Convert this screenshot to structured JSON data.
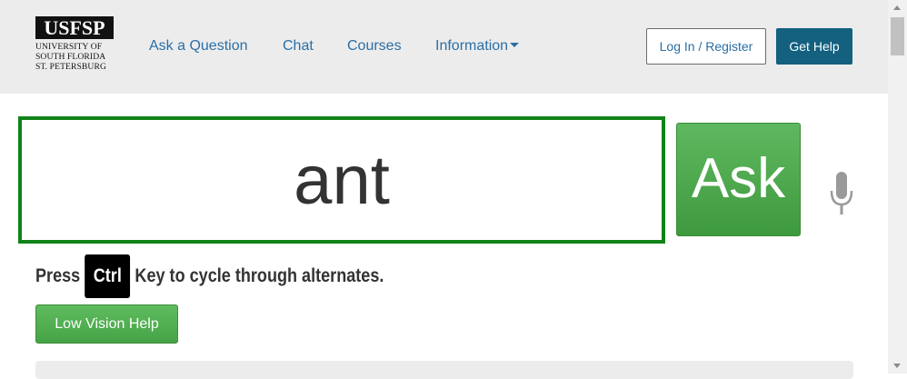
{
  "logo": {
    "mark": "USFSP",
    "lines": [
      "UNIVERSITY OF",
      "SOUTH FLORIDA",
      "ST. PETERSBURG"
    ]
  },
  "nav": {
    "items": [
      {
        "label": "Ask a Question"
      },
      {
        "label": "Chat"
      },
      {
        "label": "Courses"
      },
      {
        "label": "Information"
      }
    ]
  },
  "header_buttons": {
    "login": "Log In / Register",
    "get_help": "Get Help"
  },
  "search": {
    "value": "ant",
    "ask_label": "Ask",
    "mic_icon": "microphone-icon"
  },
  "hint": {
    "before": "Press",
    "key": "Ctrl",
    "after": "Key to cycle through alternates."
  },
  "low_vision_label": "Low Vision Help",
  "colors": {
    "header_bg": "#ececec",
    "nav_link": "#2a6fa6",
    "get_help_bg": "#13607f",
    "search_border": "#118318",
    "ask_green": "#4fa94f"
  }
}
